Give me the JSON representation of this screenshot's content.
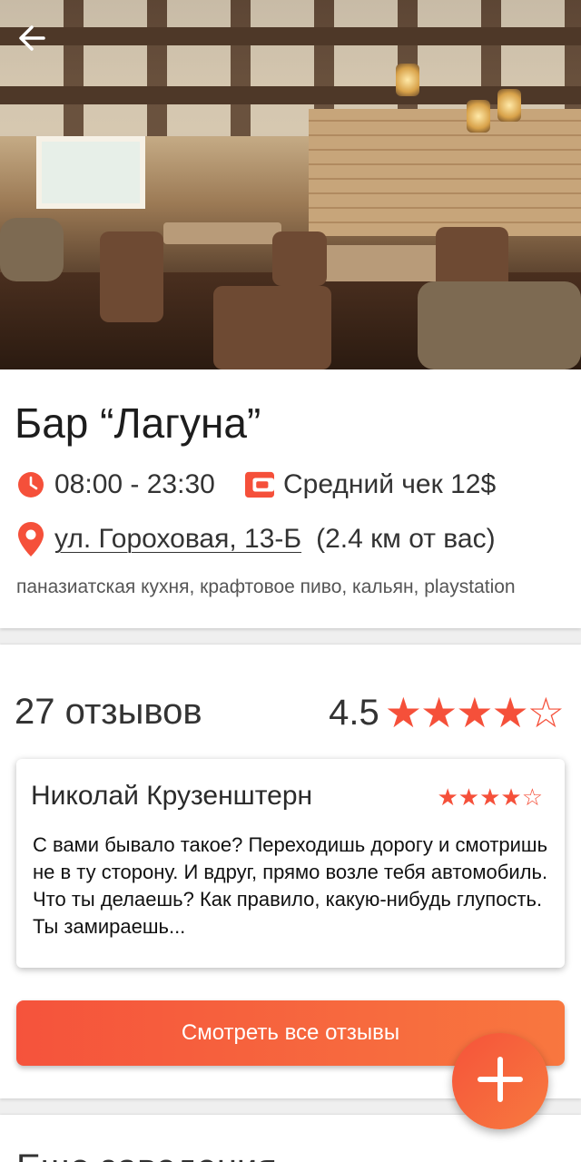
{
  "venue": {
    "name": "Бар “Лагуна”",
    "hours": "08:00 - 23:30",
    "average_check": "Средний чек 12$",
    "address": "ул. Гороховая, 13-Б",
    "distance": "(2.4 км от вас)",
    "tags": "паназиатская кухня, крафтовое пиво, кальян, playstation"
  },
  "reviews": {
    "count_label": "27 отзывов",
    "rating": "4.5",
    "rating_value": 4.5,
    "rating_max": 5,
    "items": [
      {
        "author": "Николай Крузенштерн",
        "rating_value": 4,
        "rating_max": 5,
        "text": "С вами бывало такое? Переходишь дорогу и смотришь не в ту сторону. И вдруг, прямо возле тебя автомобиль. Что ты делаешь? Как правило, какую-нибудь глупость. Ты замираешь..."
      }
    ],
    "all_button_label": "Смотреть все отзывы"
  },
  "more_section": {
    "title": "Еще заведения"
  },
  "icons": {
    "back": "arrow-left-icon",
    "clock": "clock-icon",
    "wallet": "wallet-icon",
    "location": "location-pin-icon",
    "fab": "plus-icon"
  },
  "colors": {
    "accent": "#f5503a",
    "accent_end": "#f8773f"
  }
}
